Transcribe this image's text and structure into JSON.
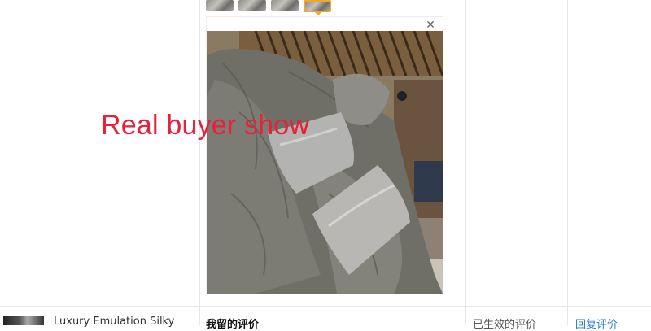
{
  "gallery": {
    "thumbnails": [
      "bedding-photo-1",
      "bedding-photo-2",
      "bedding-photo-3",
      "bedding-photo-4"
    ],
    "active_index": 3,
    "close_icon": "close-icon",
    "accent_color": "#f5a623"
  },
  "overlay_text": "Real buyer show",
  "overlay_color": "#e8203a",
  "review_row": {
    "product_title": "Luxury Emulation Silky",
    "my_review_label": "我留的评价",
    "status_label": "已生效的评价",
    "reply_label": "回复评价",
    "link_color": "#2a7ab8"
  }
}
